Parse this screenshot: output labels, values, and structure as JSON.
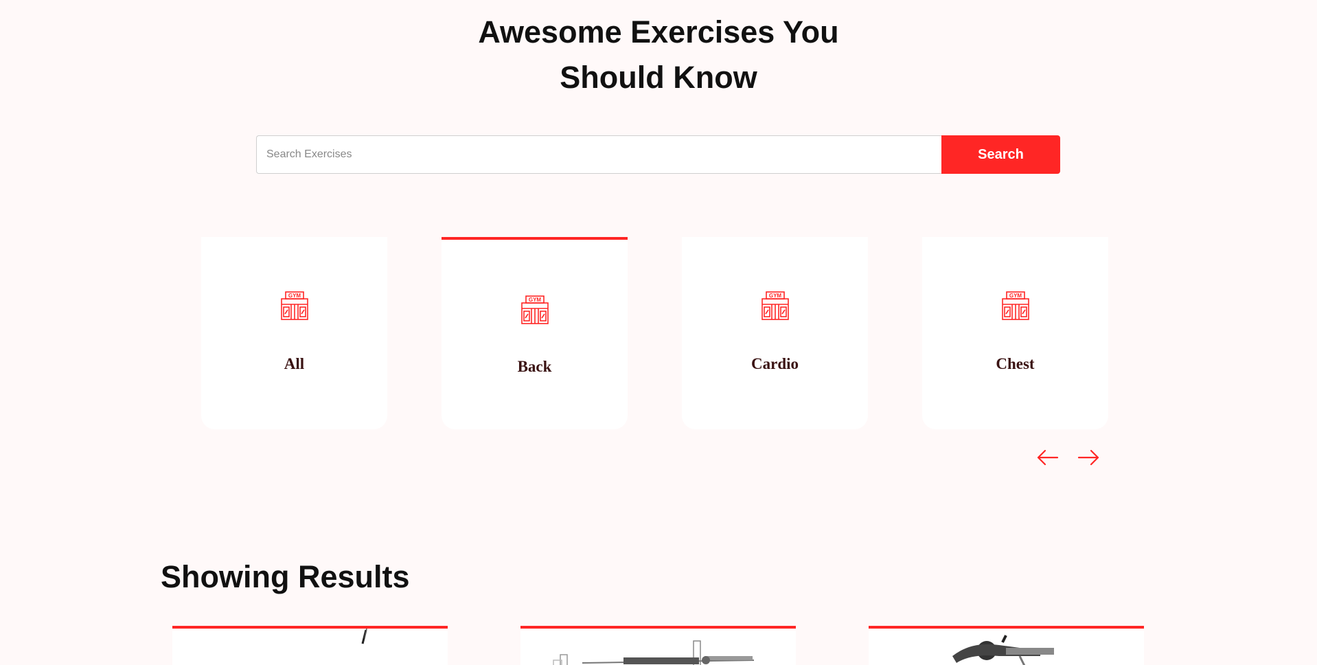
{
  "hero": {
    "title_line1": "Awesome Exercises You",
    "title_line2": "Should Know"
  },
  "search": {
    "placeholder": "Search Exercises",
    "value": "",
    "button_label": "Search"
  },
  "categories": [
    {
      "label": "All",
      "icon": "gym-icon",
      "active": false
    },
    {
      "label": "Back",
      "icon": "gym-icon",
      "active": true
    },
    {
      "label": "Cardio",
      "icon": "gym-icon",
      "active": false
    },
    {
      "label": "Chest",
      "icon": "gym-icon",
      "active": false
    }
  ],
  "carousel": {
    "prev_icon": "arrow-left-icon",
    "next_icon": "arrow-right-icon"
  },
  "results": {
    "title": "Showing Results",
    "cards": [
      {
        "image": "exercise-image"
      },
      {
        "image": "exercise-image"
      },
      {
        "image": "exercise-image"
      }
    ]
  },
  "colors": {
    "accent": "#ff2625",
    "background": "#fff9f9",
    "card": "#ffffff",
    "category_text": "#3a1212"
  }
}
